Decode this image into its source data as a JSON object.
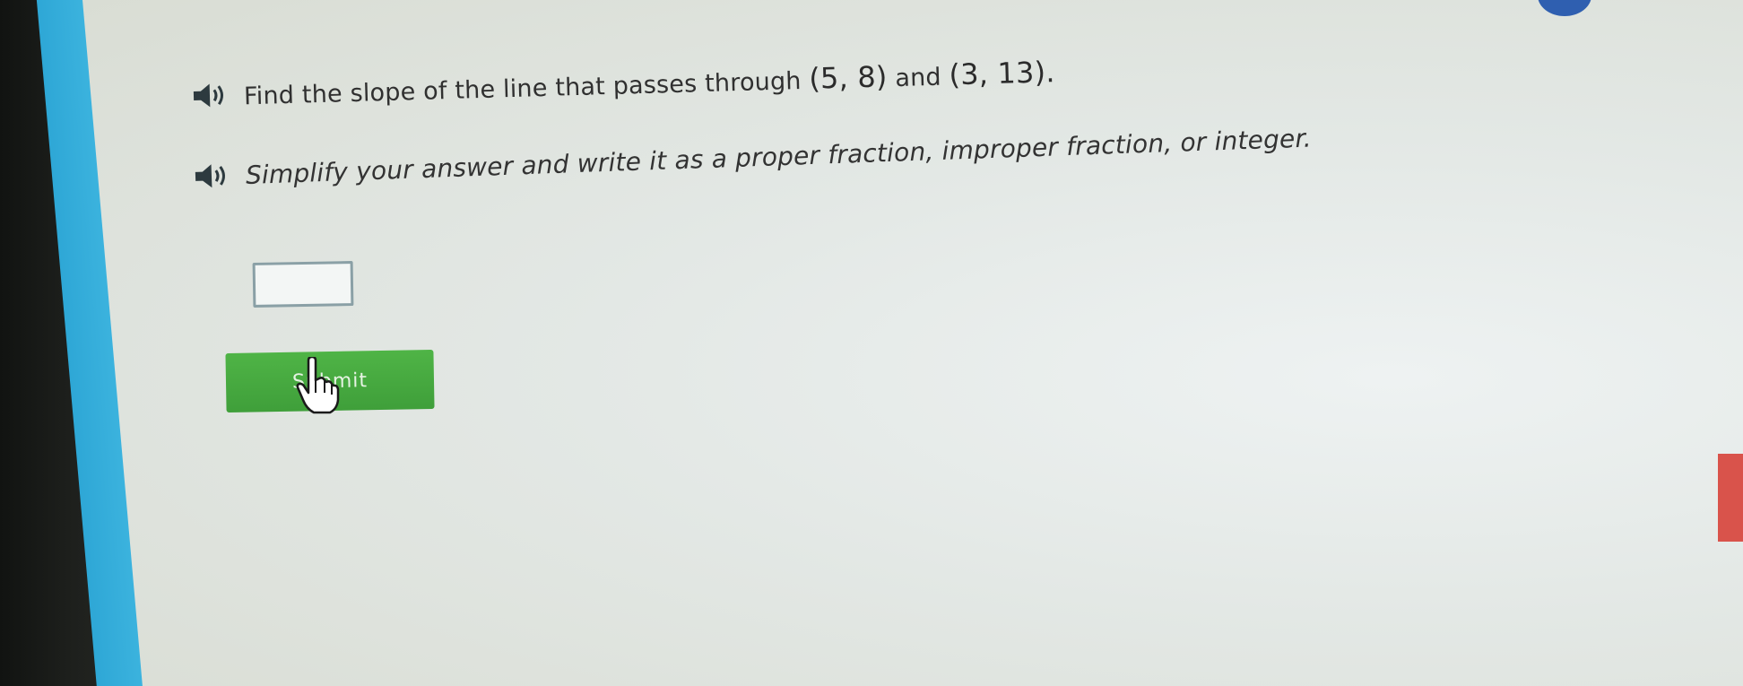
{
  "question": {
    "prompt_before": "Find the slope of the line that passes through ",
    "point_a": "(5, 8)",
    "connector": " and ",
    "point_b": "(3, 13).",
    "instruction_lead": "Simplify your answer and write it as a proper fraction, improper fraction, or integer.",
    "instruction": "Simplify your answer and write it as a proper fraction, improper fraction, or integer."
  },
  "answer": {
    "value": ""
  },
  "submit": {
    "label": "Submit"
  },
  "colors": {
    "accent_bar": "#3fb6e0",
    "submit_green": "#45a83f",
    "audio_icon": "#2d3a3f"
  },
  "icons": [
    "speaker-icon",
    "hand-cursor-icon"
  ]
}
